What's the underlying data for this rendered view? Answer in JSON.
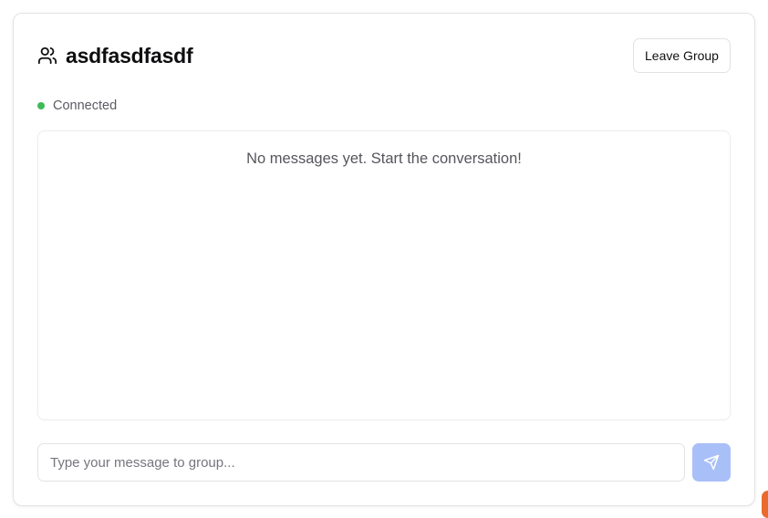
{
  "group": {
    "title": "asdfasdfasdf",
    "icon": "users-icon"
  },
  "header": {
    "leave_label": "Leave Group"
  },
  "status": {
    "label": "Connected",
    "color": "#3fba5a"
  },
  "messages": {
    "empty_text": "No messages yet. Start the conversation!"
  },
  "composer": {
    "placeholder": "Type your message to group...",
    "value": "",
    "send_icon": "send-icon",
    "send_color": "#a9bff8"
  },
  "accent": {
    "corner": "#ea6a2d"
  }
}
